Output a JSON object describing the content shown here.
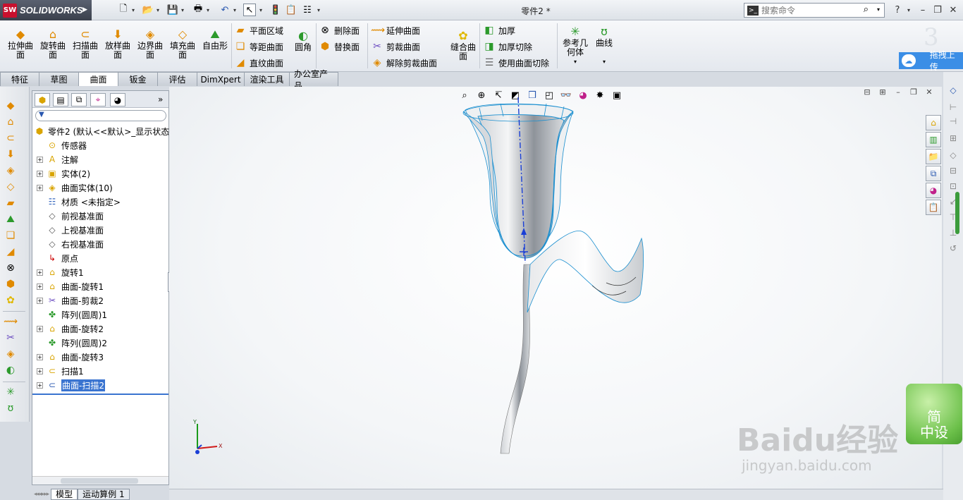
{
  "app": {
    "name": "SOLIDWORKS",
    "doc_title": "零件2 *"
  },
  "search": {
    "placeholder": "搜索命令"
  },
  "quick_toolbar": {
    "icons": [
      "new-icon",
      "open-icon",
      "save-icon",
      "print-icon",
      "undo-icon",
      "select-icon",
      "rebuild-icon",
      "options-icon",
      "file-properties-icon"
    ]
  },
  "ribbon": {
    "big_buttons": [
      {
        "label": "拉伸曲\n面",
        "icon": "extruded-surface-icon"
      },
      {
        "label": "旋转曲\n面",
        "icon": "revolved-surface-icon"
      },
      {
        "label": "扫描曲\n面",
        "icon": "swept-surface-icon"
      },
      {
        "label": "放样曲\n面",
        "icon": "lofted-surface-icon"
      },
      {
        "label": "边界曲\n面",
        "icon": "boundary-surface-icon"
      },
      {
        "label": "填充曲\n面",
        "icon": "filled-surface-icon"
      },
      {
        "label": "自由形",
        "icon": "freeform-icon"
      }
    ],
    "group1": [
      "平面区域",
      "等距曲面",
      "直纹曲面"
    ],
    "fillet": "圆角",
    "group2": [
      "删除面",
      "替换面"
    ],
    "group3": [
      "延伸曲面",
      "剪裁曲面",
      "解除剪裁曲面"
    ],
    "knit": "缝合曲\n面",
    "group4": [
      "加厚",
      "加厚切除",
      "使用曲面切除"
    ],
    "ref_geometry": "参考几\n何体",
    "curves": "曲线",
    "upload": "拖拽上传"
  },
  "tabs": [
    "特征",
    "草图",
    "曲面",
    "钣金",
    "评估",
    "DimXpert",
    "渲染工具",
    "办公室产品"
  ],
  "active_tab": "曲面",
  "tree": {
    "root": "零件2  (默认<<默认>_显示状态",
    "items": [
      {
        "label": "传感器",
        "icon": "sensor-icon",
        "expandable": false
      },
      {
        "label": "注解",
        "icon": "annotations-icon",
        "expandable": true
      },
      {
        "label": "实体(2)",
        "icon": "solid-bodies-icon",
        "expandable": true
      },
      {
        "label": "曲面实体(10)",
        "icon": "surface-bodies-icon",
        "expandable": true
      },
      {
        "label": "材质 <未指定>",
        "icon": "material-icon",
        "expandable": false
      },
      {
        "label": "前视基准面",
        "icon": "plane-icon",
        "expandable": false
      },
      {
        "label": "上视基准面",
        "icon": "plane-icon",
        "expandable": false
      },
      {
        "label": "右视基准面",
        "icon": "plane-icon",
        "expandable": false
      },
      {
        "label": "原点",
        "icon": "origin-icon",
        "expandable": false
      },
      {
        "label": "旋转1",
        "icon": "revolve-icon",
        "expandable": true
      },
      {
        "label": "曲面-旋转1",
        "icon": "surface-revolve-icon",
        "expandable": true
      },
      {
        "label": "曲面-剪裁2",
        "icon": "surface-trim-icon",
        "expandable": true
      },
      {
        "label": "阵列(圆周)1",
        "icon": "circular-pattern-icon",
        "expandable": false
      },
      {
        "label": "曲面-旋转2",
        "icon": "surface-revolve-icon",
        "expandable": true
      },
      {
        "label": "阵列(圆周)2",
        "icon": "circular-pattern-icon",
        "expandable": false
      },
      {
        "label": "曲面-旋转3",
        "icon": "surface-revolve-icon",
        "expandable": true
      },
      {
        "label": "扫描1",
        "icon": "sweep-icon",
        "expandable": true
      },
      {
        "label": "曲面-扫描2",
        "icon": "surface-sweep-icon",
        "expandable": true,
        "selected": true
      }
    ]
  },
  "bottom_tabs": [
    "模型",
    "运动算例 1"
  ],
  "triad": {
    "x": "X",
    "y": "Y"
  },
  "watermark": {
    "badge": "简\n中设",
    "brand": "Baidu经验",
    "url": "jingyan.baidu.com"
  },
  "colors": {
    "accent": "#3a74d0",
    "brand": "#c8102e",
    "curve": "#1a5fd6"
  }
}
